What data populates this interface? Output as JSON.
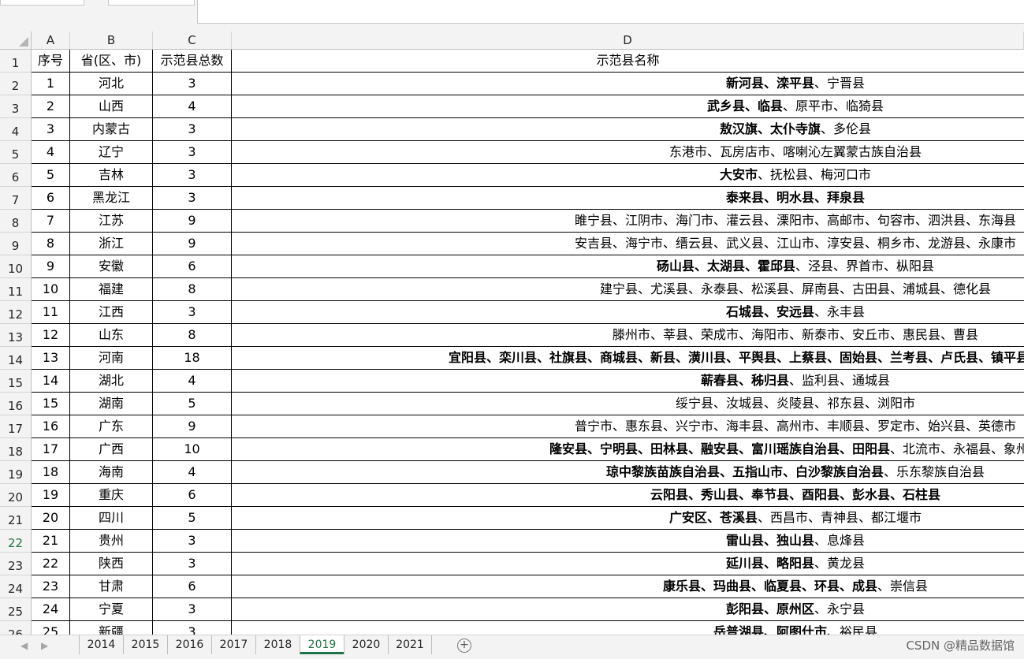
{
  "columns": [
    "A",
    "B",
    "C",
    "D"
  ],
  "header": {
    "index": "序号",
    "province": "省(区、市)",
    "count": "示范县总数",
    "names": "示范县名称"
  },
  "rows": [
    {
      "idx": "1",
      "prov": "河北",
      "count": "3",
      "names": [
        [
          "新河县、滦平县",
          true
        ],
        [
          "、宁晋县",
          false
        ]
      ]
    },
    {
      "idx": "2",
      "prov": "山西",
      "count": "4",
      "names": [
        [
          "武乡县、临县",
          true
        ],
        [
          "、原平市、临猗县",
          false
        ]
      ]
    },
    {
      "idx": "3",
      "prov": "内蒙古",
      "count": "3",
      "names": [
        [
          "敖汉旗、太仆寺旗",
          true
        ],
        [
          "、多伦县",
          false
        ]
      ]
    },
    {
      "idx": "4",
      "prov": "辽宁",
      "count": "3",
      "names": [
        [
          "东港市、瓦房店市、喀喇沁左翼蒙古族自治县",
          false
        ]
      ]
    },
    {
      "idx": "5",
      "prov": "吉林",
      "count": "3",
      "names": [
        [
          "大安市",
          true
        ],
        [
          "、抚松县、梅河口市",
          false
        ]
      ]
    },
    {
      "idx": "6",
      "prov": "黑龙江",
      "count": "3",
      "names": [
        [
          "泰来县、明水县、拜泉县",
          true
        ]
      ]
    },
    {
      "idx": "7",
      "prov": "江苏",
      "count": "9",
      "names": [
        [
          "睢宁县、江阴市、海门市、灌云县、溧阳市、高邮市、句容市、泗洪县、东海县",
          false
        ]
      ]
    },
    {
      "idx": "8",
      "prov": "浙江",
      "count": "9",
      "names": [
        [
          "安吉县、海宁市、缙云县、武义县、江山市、淳安县、桐乡市、龙游县、永康市",
          false
        ]
      ]
    },
    {
      "idx": "9",
      "prov": "安徽",
      "count": "6",
      "names": [
        [
          "砀山县、太湖县、霍邱县",
          true
        ],
        [
          "、泾县、界首市、枞阳县",
          false
        ]
      ]
    },
    {
      "idx": "10",
      "prov": "福建",
      "count": "8",
      "names": [
        [
          "建宁县、尤溪县、永泰县、松溪县、屏南县、古田县、浦城县、德化县",
          false
        ]
      ]
    },
    {
      "idx": "11",
      "prov": "江西",
      "count": "3",
      "names": [
        [
          "石城县、安远县",
          true
        ],
        [
          "、永丰县",
          false
        ]
      ]
    },
    {
      "idx": "12",
      "prov": "山东",
      "count": "8",
      "names": [
        [
          "滕州市、莘县、荣成市、海阳市、新泰市、安丘市、惠民县、曹县",
          false
        ]
      ]
    },
    {
      "idx": "13",
      "prov": "河南",
      "count": "18",
      "names": [
        [
          "宜阳县、栾川县、社旗县、商城县、新县、潢川县、平舆县、上蔡县、固始县、兰考县、卢氏县、镇平县、光山县、淮滨县、",
          true
        ]
      ]
    },
    {
      "idx": "14",
      "prov": "湖北",
      "count": "4",
      "names": [
        [
          "蕲春县、秭归县",
          true
        ],
        [
          "、监利县、通城县",
          false
        ]
      ]
    },
    {
      "idx": "15",
      "prov": "湖南",
      "count": "5",
      "names": [
        [
          "绥宁县、汝城县、炎陵县、祁东县、浏阳市",
          false
        ]
      ]
    },
    {
      "idx": "16",
      "prov": "广东",
      "count": "9",
      "names": [
        [
          "普宁市、惠东县、兴宁市、海丰县、高州市、丰顺县、罗定市、始兴县、英德市",
          false
        ]
      ]
    },
    {
      "idx": "17",
      "prov": "广西",
      "count": "10",
      "names": [
        [
          "隆安县、宁明县、田林县、融安县、富川瑶族自治县、田阳县",
          true
        ],
        [
          "、北流市、永福县、象州县",
          false
        ]
      ]
    },
    {
      "idx": "18",
      "prov": "海南",
      "count": "4",
      "names": [
        [
          "琼中黎族苗族自治县、五指山市、白沙黎族自治县",
          true
        ],
        [
          "、乐东黎族自治县",
          false
        ]
      ]
    },
    {
      "idx": "19",
      "prov": "重庆",
      "count": "6",
      "names": [
        [
          "云阳县、秀山县、奉节县、酉阳县、彭水县、石柱县",
          true
        ]
      ]
    },
    {
      "idx": "20",
      "prov": "四川",
      "count": "5",
      "names": [
        [
          "广安区、苍溪县",
          true
        ],
        [
          "、西昌市、青神县、都江堰市",
          false
        ]
      ]
    },
    {
      "idx": "21",
      "prov": "贵州",
      "count": "3",
      "names": [
        [
          "雷山县、独山县",
          true
        ],
        [
          "、息烽县",
          false
        ]
      ]
    },
    {
      "idx": "22",
      "prov": "陕西",
      "count": "3",
      "names": [
        [
          "延川县、略阳县",
          true
        ],
        [
          "、黄龙县",
          false
        ]
      ]
    },
    {
      "idx": "23",
      "prov": "甘肃",
      "count": "6",
      "names": [
        [
          "康乐县、玛曲县、临夏县、环县、成县",
          true
        ],
        [
          "、崇信县",
          false
        ]
      ]
    },
    {
      "idx": "24",
      "prov": "宁夏",
      "count": "3",
      "names": [
        [
          "彭阳县、原州区",
          true
        ],
        [
          "、永宁县",
          false
        ]
      ]
    },
    {
      "idx": "25",
      "prov": "新疆",
      "count": "3",
      "names": [
        [
          "岳普湖县、阿图什市",
          true
        ],
        [
          "、裕民县",
          false
        ]
      ]
    }
  ],
  "active_row": "22",
  "sheets": [
    "2014",
    "2015",
    "2016",
    "2017",
    "2018",
    "2019",
    "2020",
    "2021"
  ],
  "active_sheet": "2019",
  "watermark": "CSDN @精品数据馆",
  "colors": {
    "accent": "#217346"
  }
}
